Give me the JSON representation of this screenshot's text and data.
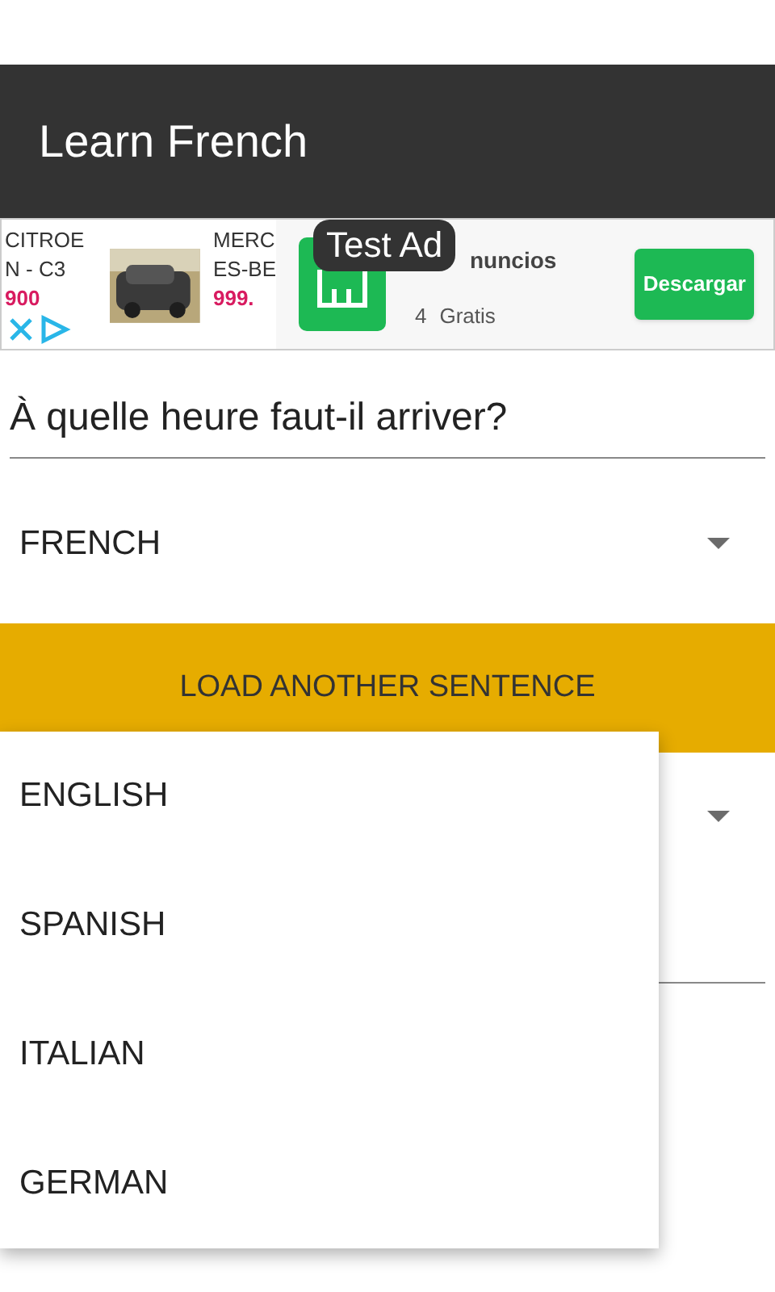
{
  "app_bar": {
    "title": "Learn French"
  },
  "ad": {
    "badge": "Test Ad",
    "listings": [
      {
        "title_lines": [
          "CITROE",
          "N - C3"
        ],
        "price": "900"
      },
      {
        "title_lines": [
          "MERC",
          "ES-BE"
        ],
        "price": "999."
      }
    ],
    "app": {
      "name": "nuncios",
      "rating": "4",
      "price": "Gratis",
      "button": "Descargar"
    }
  },
  "sentence": {
    "value": "À quelle heure faut-il arriver?"
  },
  "source_language": {
    "value": "FRENCH"
  },
  "load_button": {
    "label": "LOAD ANOTHER SENTENCE"
  },
  "language_menu": {
    "options": [
      "ENGLISH",
      "SPANISH",
      "ITALIAN",
      "GERMAN"
    ]
  }
}
